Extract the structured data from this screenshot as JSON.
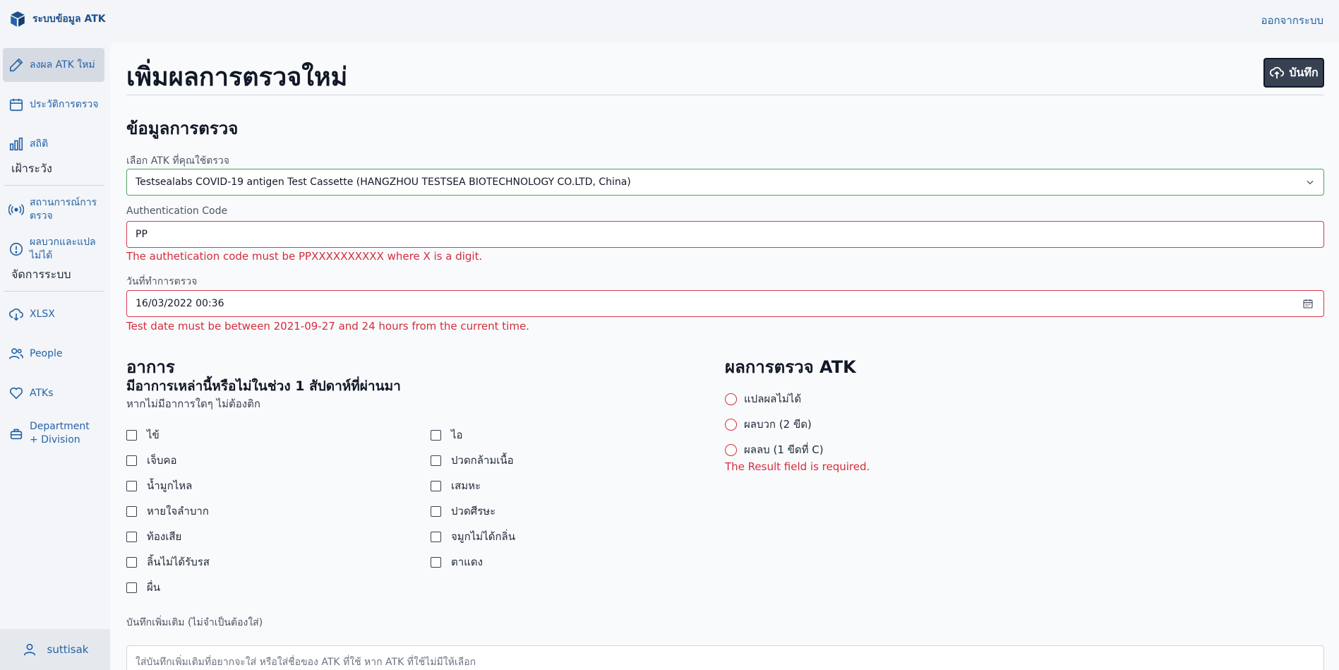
{
  "app": {
    "title": "ระบบข้อมูล ATK",
    "logout": "ออกจากระบบ"
  },
  "sidebar": {
    "items": [
      {
        "label": "ลงผล ATK ใหม่",
        "icon": "pencil-icon",
        "active": true
      },
      {
        "label": "ประวัติการตรวจ",
        "icon": "calendar-icon"
      },
      {
        "label": "สถิติ",
        "icon": "bar-chart-icon"
      }
    ],
    "section_watch": "เฝ้าระวัง",
    "watch_items": [
      {
        "label": "สถานการณ์การตรวจ",
        "icon": "broadcast-icon"
      },
      {
        "label": "ผลบวกและแปลไม่ได้",
        "icon": "alert-circle-icon"
      }
    ],
    "section_admin": "จัดการระบบ",
    "admin_items": [
      {
        "label": "XLSX",
        "icon": "cloud-download-icon"
      },
      {
        "label": "People",
        "icon": "users-icon"
      },
      {
        "label": "ATKs",
        "icon": "heart-icon"
      },
      {
        "label": "Department + Division",
        "icon": "briefcase-icon"
      }
    ],
    "user": "suttisak"
  },
  "main": {
    "title": "เพิ่มผลการตรวจใหม่",
    "save_label": "บันทึก",
    "section_title": "ข้อมูลการตรวจ",
    "atk_label": "เลือก ATK ที่คุณใช้ตรวจ",
    "atk_value": "Testsealabs COVID-19 antigen Test Cassette (HANGZHOU TESTSEA BIOTECHNOLOGY CO.LTD, China)",
    "auth_label": "Authentication Code",
    "auth_value": "PP",
    "auth_error": "The authetication code must be PPXXXXXXXXXX where X is a digit.",
    "date_label": "วันที่ทำการตรวจ",
    "date_value": "16/03/2022 00:36",
    "date_error": "Test date must be between 2021-09-27 and 24 hours from the current time.",
    "symptoms_title": "อาการ",
    "symptoms_subtitle": "มีอาการเหล่านี้หรือไม่ในช่วง 1 สัปดาห์ที่ผ่านมา",
    "symptoms_hint": "หากไม่มีอาการใดๆ ไม่ต้องติก",
    "symptoms_left": [
      "ไข้",
      "เจ็บคอ",
      "น้ำมูกไหล",
      "หายใจลำบาก",
      "ท้องเสีย",
      "ลิ้นไม่ได้รับรส",
      "ผื่น"
    ],
    "symptoms_right": [
      "ไอ",
      "ปวดกล้ามเนื้อ",
      "เสมหะ",
      "ปวดศีรษะ",
      "จมูกไม่ได้กลิ่น",
      "ตาแดง"
    ],
    "result_title": "ผลการตรวจ ATK",
    "result_options": [
      "แปลผลไม่ได้",
      "ผลบวก (2 ขีด)",
      "ผลลบ (1 ขีดที่ C)"
    ],
    "result_error": "The Result field is required.",
    "notes_label": "บันทึกเพิ่มเติม (ไม่จำเป็นต้องใส่)",
    "notes_placeholder": "ใส่บันทึกเพิ่มเติมที่อยากจะใส่ หรือใส่ชื่อของ ATK ที่ใช้ หาก ATK ที่ใช้ไม่มีให้เลือก"
  },
  "colors": {
    "accent": "#2563a8",
    "error": "#d52d3c",
    "success": "#4aa563",
    "button": "#374151"
  }
}
